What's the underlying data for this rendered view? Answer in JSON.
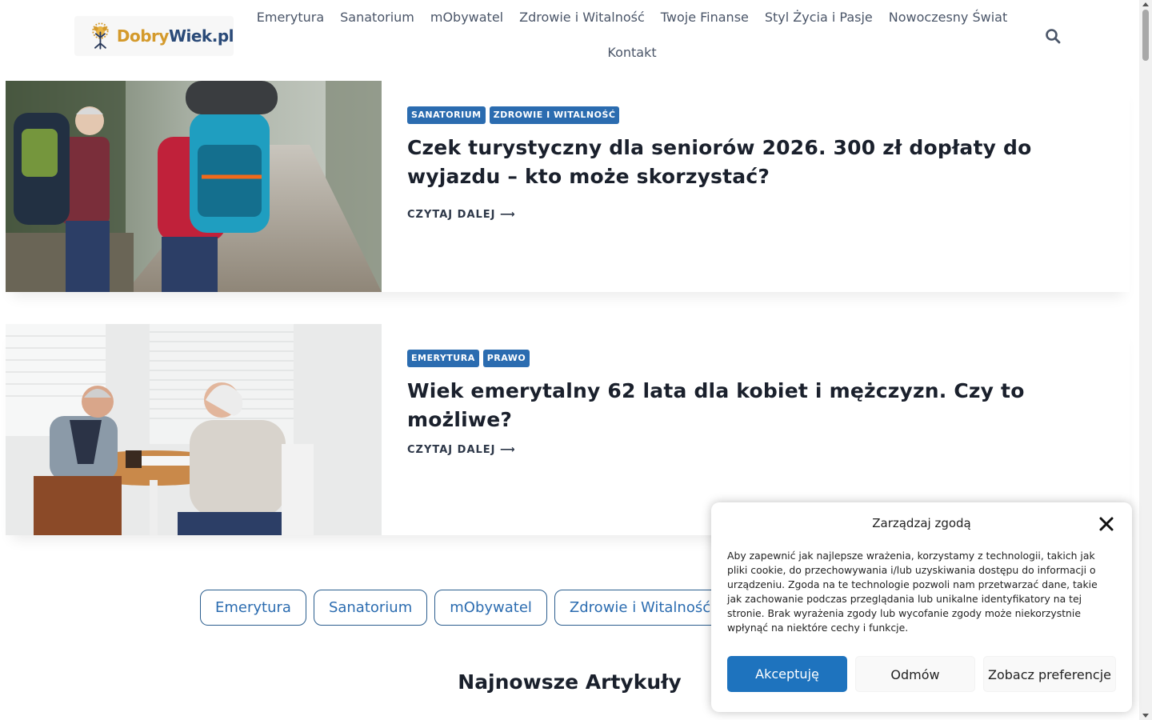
{
  "header": {
    "logo": {
      "part1": "Dobry",
      "part2": "Wiek.pl"
    },
    "nav": [
      "Emerytura",
      "Sanatorium",
      "mObywatel",
      "Zdrowie i Witalność",
      "Twoje Finanse",
      "Styl Życia i Pasje",
      "Nowoczesny Świat",
      "Kontakt"
    ],
    "search_icon": "search-icon"
  },
  "articles": [
    {
      "tags": [
        "SANATORIUM",
        "ZDROWIE I WITALNOŚĆ"
      ],
      "title": "Czek turystyczny dla seniorów 2026. 300 zł dopłaty do wyjazdu – kto może skorzystać?",
      "readmore": "CZYTAJ DALEJ ⟶"
    },
    {
      "tags": [
        "EMERYTURA",
        "PRAWO"
      ],
      "title": "Wiek emerytalny 62 lata dla kobiet i mężczyzn. Czy to możliwe?",
      "readmore": "CZYTAJ DALEJ ⟶"
    }
  ],
  "category_pills": [
    "Emerytura",
    "Sanatorium",
    "mObywatel",
    "Zdrowie i Witalność"
  ],
  "section_title": "Najnowsze Artykuły",
  "consent": {
    "title": "Zarządzaj zgodą",
    "text": "Aby zapewnić jak najlepsze wrażenia, korzystamy z technologii, takich jak pliki cookie, do przechowywania i/lub uzyskiwania dostępu do informacji o urządzeniu. Zgoda na te technologie pozwoli nam przetwarzać dane, takie jak zachowanie podczas przeglądania lub unikalne identyfikatory na tej stronie. Brak wyrażenia zgody lub wycofanie zgody może niekorzystnie wpłynąć na niektóre cechy i funkcje.",
    "accept": "Akceptuję",
    "deny": "Odmów",
    "preferences": "Zobacz preferencje"
  },
  "colors": {
    "accent": "#2b6cb0",
    "accept_button": "#1e73be",
    "logo_gold": "#d49a2c",
    "logo_navy": "#2a4a78"
  }
}
